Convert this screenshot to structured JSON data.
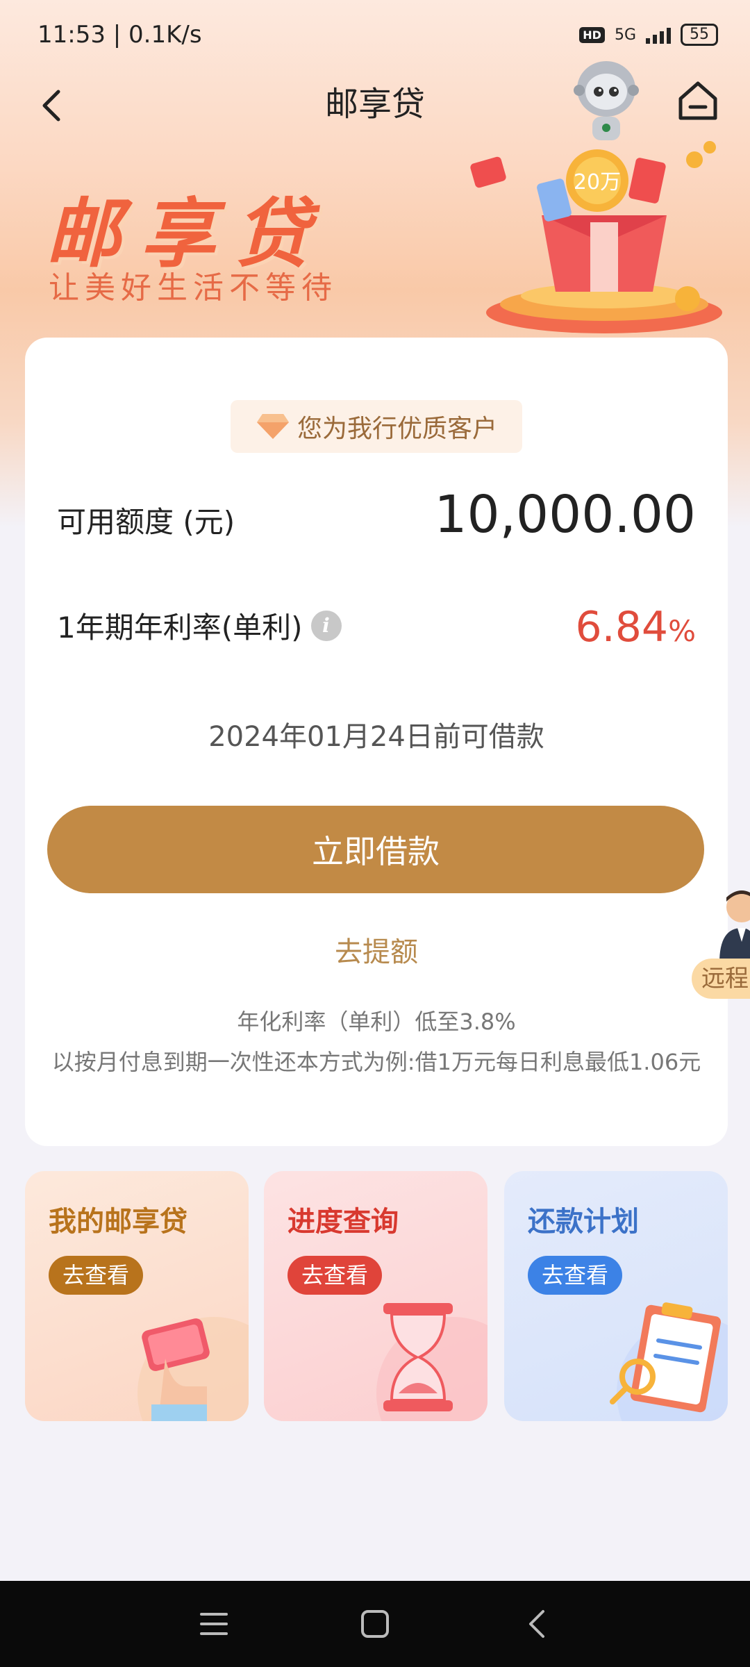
{
  "status_bar": {
    "time_speed": "11:53 | 0.1K/s",
    "hd": "HD",
    "network": "5G",
    "battery": "55"
  },
  "nav": {
    "title": "邮享贷"
  },
  "banner": {
    "title": "邮享贷",
    "subtitle": "让美好生活不等待",
    "gift_label": "20万"
  },
  "card": {
    "vip_badge": "您为我行优质客户",
    "credit_label": "可用额度 (元)",
    "credit_value": "10,000.00",
    "rate_label": "1年期年利率(单利)",
    "rate_value": "6.84",
    "rate_unit": "%",
    "deadline": "2024年01月24日前可借款",
    "borrow_button": "立即借款",
    "raise_limit_link": "去提额",
    "note_rate": "年化利率（单利）低至3.8%",
    "note_example": "以按月付息到期一次性还本方式为例:借1万元每日利息最低1.06元"
  },
  "float_service": {
    "label": "远程"
  },
  "tiles": [
    {
      "title": "我的邮享贷",
      "button": "去查看"
    },
    {
      "title": "进度查询",
      "button": "去查看"
    },
    {
      "title": "还款计划",
      "button": "去查看"
    }
  ]
}
